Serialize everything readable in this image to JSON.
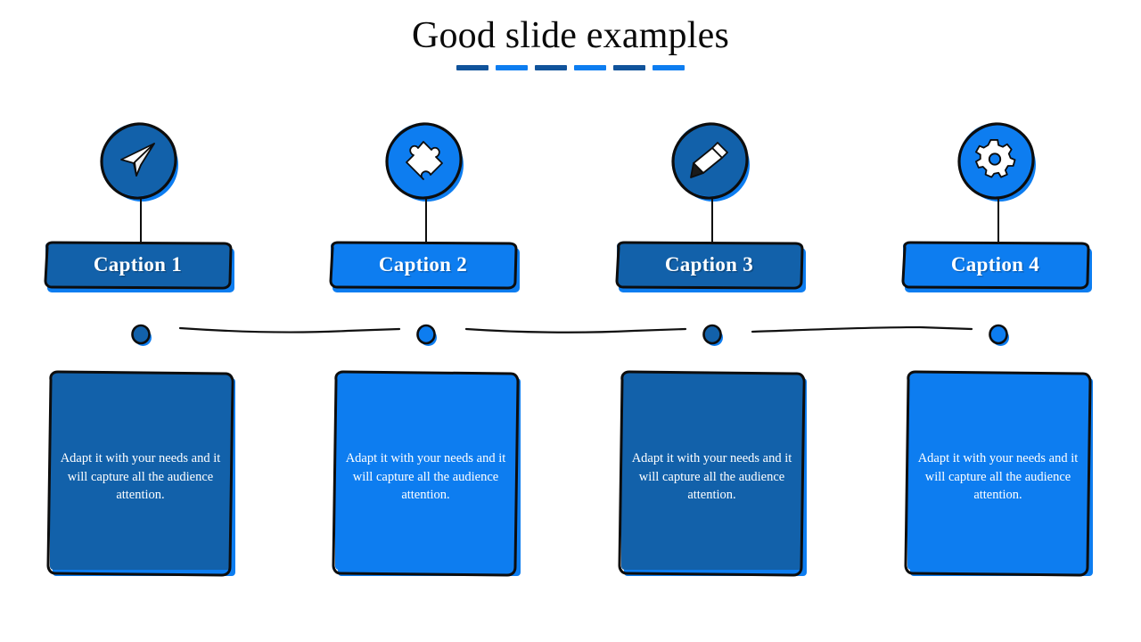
{
  "slide": {
    "title": "Good slide examples",
    "background_color": "#ffffff",
    "title_color": "#0a0a0a"
  },
  "palette": {
    "dark_blue": "#1261aa",
    "bright_blue": "#0d7df0",
    "outline": "#0d0d0d",
    "text_on_blue": "#ffffff"
  },
  "title_underline": {
    "dashes": [
      {
        "color": "#10539b"
      },
      {
        "color": "#0d7df0"
      },
      {
        "color": "#10539b"
      },
      {
        "color": "#0d7df0"
      },
      {
        "color": "#10539b"
      },
      {
        "color": "#0d7df0"
      }
    ]
  },
  "body_text": "Adapt it with your needs and it will capture all the audience attention.",
  "columns": [
    {
      "icon": "paper-plane-icon",
      "icon_color": "#1261aa",
      "caption": "Caption 1",
      "caption_color": "#1261aa",
      "caption_shadow_color": "#0d7df0",
      "dot_color": "#1261aa",
      "card_color": "#1261aa",
      "card_shadow_color": "#0d7df0",
      "body": "Adapt it with your needs and it will capture all the audience attention."
    },
    {
      "icon": "puzzle-piece-icon",
      "icon_color": "#0d7df0",
      "caption": "Caption 2",
      "caption_color": "#0d7df0",
      "caption_shadow_color": "#0d7df0",
      "dot_color": "#0d7df0",
      "card_color": "#0d7df0",
      "card_shadow_color": "#0d7df0",
      "body": "Adapt it with your needs and it will capture all the audience attention."
    },
    {
      "icon": "pencil-icon",
      "icon_color": "#1261aa",
      "caption": "Caption 3",
      "caption_color": "#1261aa",
      "caption_shadow_color": "#0d7df0",
      "dot_color": "#1261aa",
      "card_color": "#1261aa",
      "card_shadow_color": "#0d7df0",
      "body": "Adapt it with your needs and it will capture all the audience attention."
    },
    {
      "icon": "gear-icon",
      "icon_color": "#0d7df0",
      "caption": "Caption 4",
      "caption_color": "#0d7df0",
      "caption_shadow_color": "#0d7df0",
      "dot_color": "#0d7df0",
      "card_color": "#0d7df0",
      "card_shadow_color": "#0d7df0",
      "body": "Adapt it with your needs and it will capture all the audience attention."
    }
  ]
}
